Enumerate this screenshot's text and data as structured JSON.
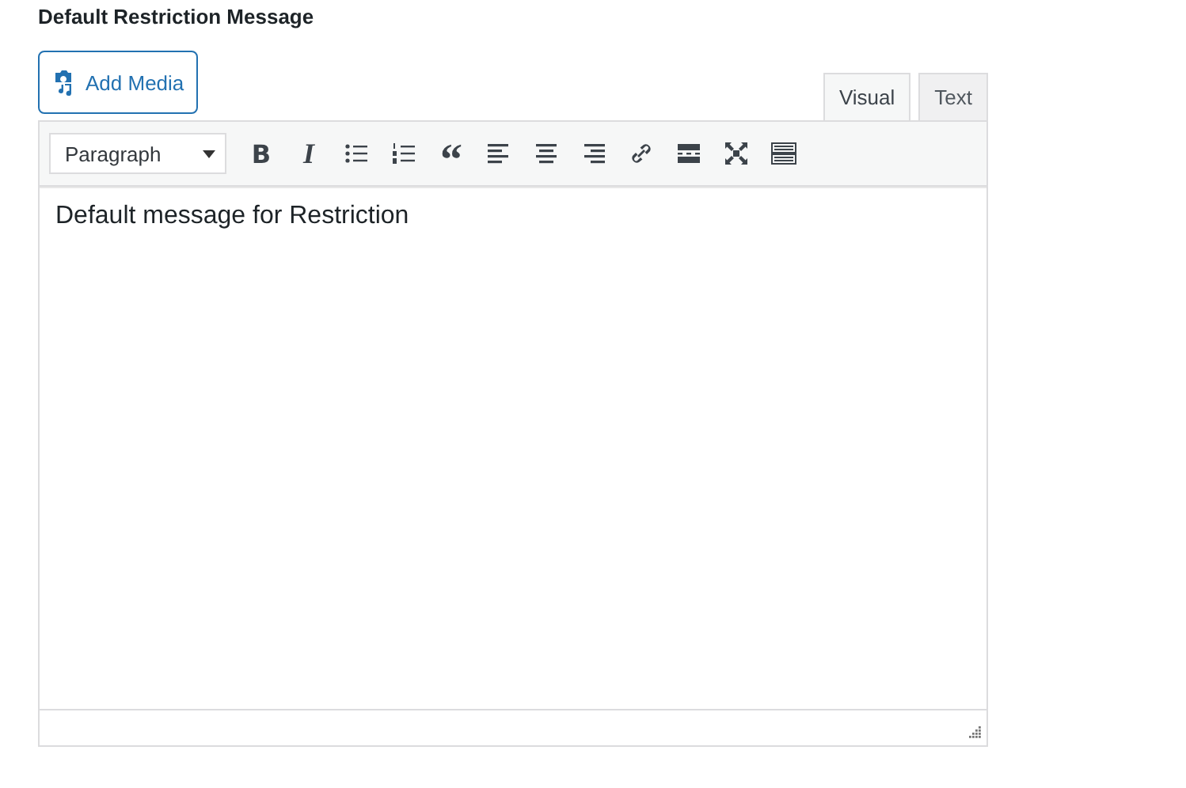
{
  "field_label": "Default Restriction Message",
  "add_media_button": "Add Media",
  "tabs": [
    {
      "label": "Visual",
      "selected": true
    },
    {
      "label": "Text",
      "selected": false
    }
  ],
  "format_select": {
    "value": "Paragraph"
  },
  "toolbar": [
    {
      "kind": "bold",
      "label": "B"
    },
    {
      "kind": "italic",
      "label": "I"
    },
    {
      "kind": "bullet-list"
    },
    {
      "kind": "numbered-list"
    },
    {
      "kind": "quote",
      "label": "“"
    },
    {
      "kind": "align-left"
    },
    {
      "kind": "align-center"
    },
    {
      "kind": "align-right"
    },
    {
      "kind": "link"
    },
    {
      "kind": "read-more"
    },
    {
      "kind": "fullscreen"
    },
    {
      "kind": "keyboard"
    }
  ],
  "content": "Default message for Restriction"
}
